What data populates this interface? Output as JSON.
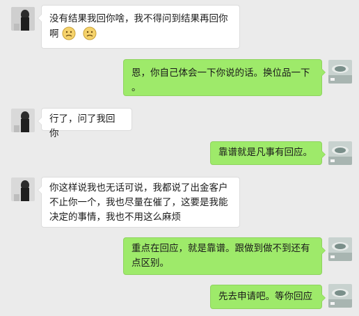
{
  "chat": {
    "messages": [
      {
        "side": "left",
        "line1": "没有结果我回你啥，我不得问到结果再回你",
        "line2": "啊",
        "emojis": [
          "frown-emoji",
          "frown-emoji"
        ]
      },
      {
        "side": "right",
        "line1": "恩，你自己体会一下你说的话。换位品一下",
        "line2": "。"
      },
      {
        "side": "left",
        "text": "行了，问了我回你"
      },
      {
        "side": "right",
        "text": "靠谱就是凡事有回应。"
      },
      {
        "side": "left",
        "line1": "你这样说我也无话可说，我都说了出金客户",
        "line2": "不止你一个，我也尽量在催了，这要是我能",
        "line3": "决定的事情，我也不用这么麻烦"
      },
      {
        "side": "right",
        "line1": "重点在回应，就是靠谱。跟做到做不到还有",
        "line2": "点区别。"
      },
      {
        "side": "right",
        "text": "先去申请吧。等你回应"
      }
    ]
  },
  "colors": {
    "background": "#ebebeb",
    "incoming_bubble": "#ffffff",
    "outgoing_bubble": "#9eea6a"
  }
}
